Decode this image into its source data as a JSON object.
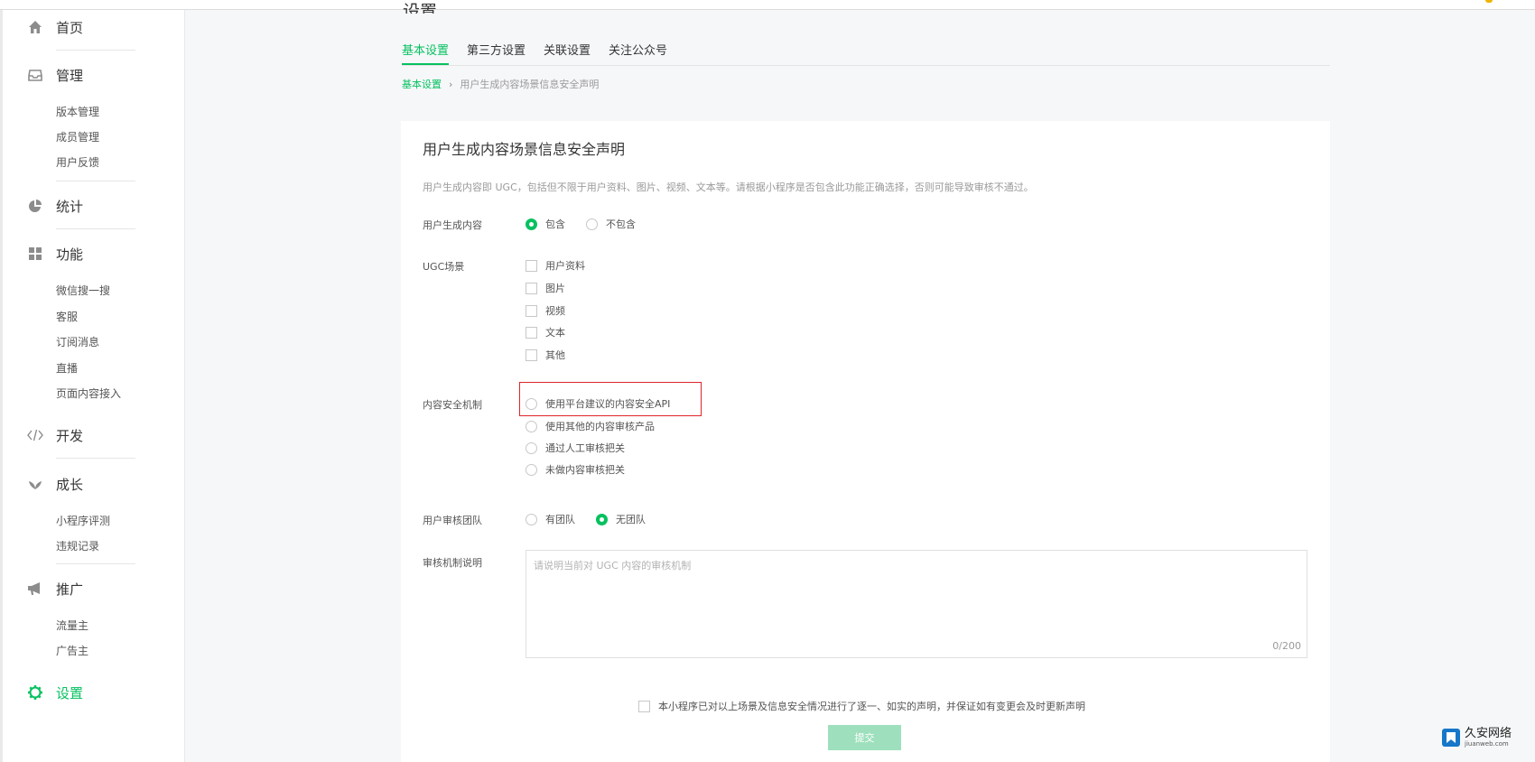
{
  "colors": {
    "accent": "#07c160",
    "highlight": "#e0242a",
    "submit_disabled": "#9ee0bd"
  },
  "sidebar": {
    "home": {
      "label": "首页",
      "icon": "home-icon"
    },
    "manage": {
      "label": "管理",
      "icon": "inbox-icon",
      "items": [
        "版本管理",
        "成员管理",
        "用户反馈"
      ]
    },
    "stats": {
      "label": "统计",
      "icon": "pie-chart-icon"
    },
    "features": {
      "label": "功能",
      "icon": "grid-icon",
      "items": [
        "微信搜一搜",
        "客服",
        "订阅消息",
        "直播",
        "页面内容接入"
      ]
    },
    "dev": {
      "label": "开发",
      "icon": "code-icon"
    },
    "growth": {
      "label": "成长",
      "icon": "leaf-icon",
      "items": [
        "小程序评测",
        "违规记录"
      ]
    },
    "promo": {
      "label": "推广",
      "icon": "megaphone-icon",
      "items": [
        "流量主",
        "广告主"
      ]
    },
    "settings": {
      "label": "设置",
      "icon": "gear-icon"
    }
  },
  "page_title": "设置",
  "tabs": [
    "基本设置",
    "第三方设置",
    "关联设置",
    "关注公众号"
  ],
  "breadcrumb": {
    "root": "基本设置",
    "sep": "›",
    "current": "用户生成内容场景信息安全声明"
  },
  "card": {
    "title": "用户生成内容场景信息安全声明",
    "desc": "用户生成内容即 UGC，包括但不限于用户资料、图片、视频、文本等。请根据小程序是否包含此功能正确选择，否则可能导致审核不通过。",
    "ugc": {
      "label": "用户生成内容",
      "options": [
        "包含",
        "不包含"
      ],
      "selected": "包含"
    },
    "scenes": {
      "label": "UGC场景",
      "options": [
        "用户资料",
        "图片",
        "视频",
        "文本",
        "其他"
      ]
    },
    "mechanism": {
      "label": "内容安全机制",
      "options": [
        "使用平台建议的内容安全API",
        "使用其他的内容审核产品",
        "通过人工审核把关",
        "未做内容审核把关"
      ]
    },
    "team": {
      "label": "用户审核团队",
      "options": [
        "有团队",
        "无团队"
      ],
      "selected": "无团队"
    },
    "review": {
      "label": "审核机制说明",
      "placeholder": "请说明当前对 UGC 内容的审核机制",
      "counter": "0/200"
    },
    "agree": "本小程序已对以上场景及信息安全情况进行了逐一、如实的声明，并保证如有变更会及时更新声明",
    "submit": "提交"
  },
  "watermark": {
    "title": "久安网络",
    "url": "jiuanweb.com"
  }
}
